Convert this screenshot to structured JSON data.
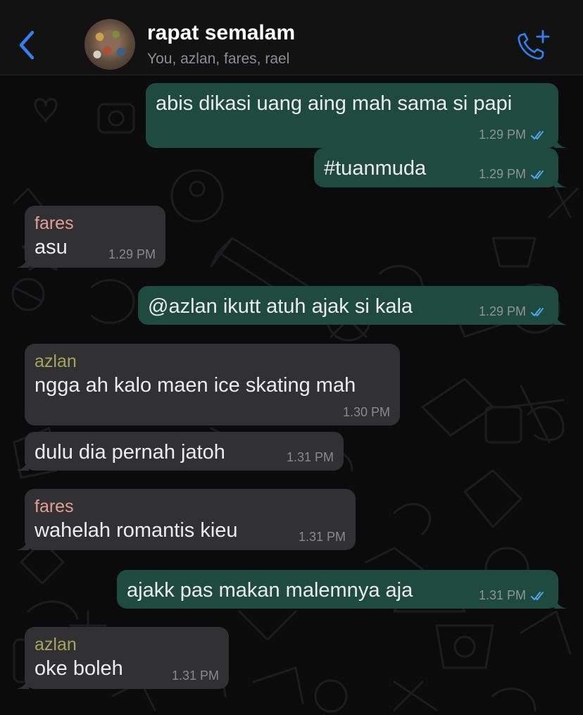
{
  "header": {
    "back_icon": "chevron-left-icon",
    "title": "rapat semalam",
    "subtitle": "You, azlan, fares, rael",
    "call_icon": "phone-add-icon",
    "accent": "#2f82f0"
  },
  "colors": {
    "outgoing_bubble": "#1f4a3f",
    "incoming_bubble": "#313133",
    "fares_name": "#e39f91",
    "azlan_name": "#a7a35c",
    "read_ticks": "#4fa6e8"
  },
  "messages": [
    {
      "direction": "out",
      "text": "abis dikasi uang aing mah sama si papi",
      "time": "1.29 PM",
      "status": "read"
    },
    {
      "direction": "out",
      "text": "#tuanmuda",
      "time": "1.29 PM",
      "status": "read"
    },
    {
      "direction": "in",
      "sender": "fares",
      "text": "asu",
      "time": "1.29 PM"
    },
    {
      "direction": "out",
      "text": "@azlan ikutt atuh ajak si kala",
      "time": "1.29 PM",
      "status": "read"
    },
    {
      "direction": "in",
      "sender": "azlan",
      "text": "ngga ah kalo maen ice skating mah",
      "time": "1.30 PM"
    },
    {
      "direction": "in",
      "text": "dulu dia pernah jatoh",
      "time": "1.31 PM"
    },
    {
      "direction": "in",
      "sender": "fares",
      "text": "wahelah romantis kieu",
      "time": "1.31 PM"
    },
    {
      "direction": "out",
      "text": "ajakk pas makan malemnya aja",
      "time": "1.31 PM",
      "status": "read"
    },
    {
      "direction": "in",
      "sender": "azlan",
      "text": "oke boleh",
      "time": "1.31 PM"
    }
  ]
}
